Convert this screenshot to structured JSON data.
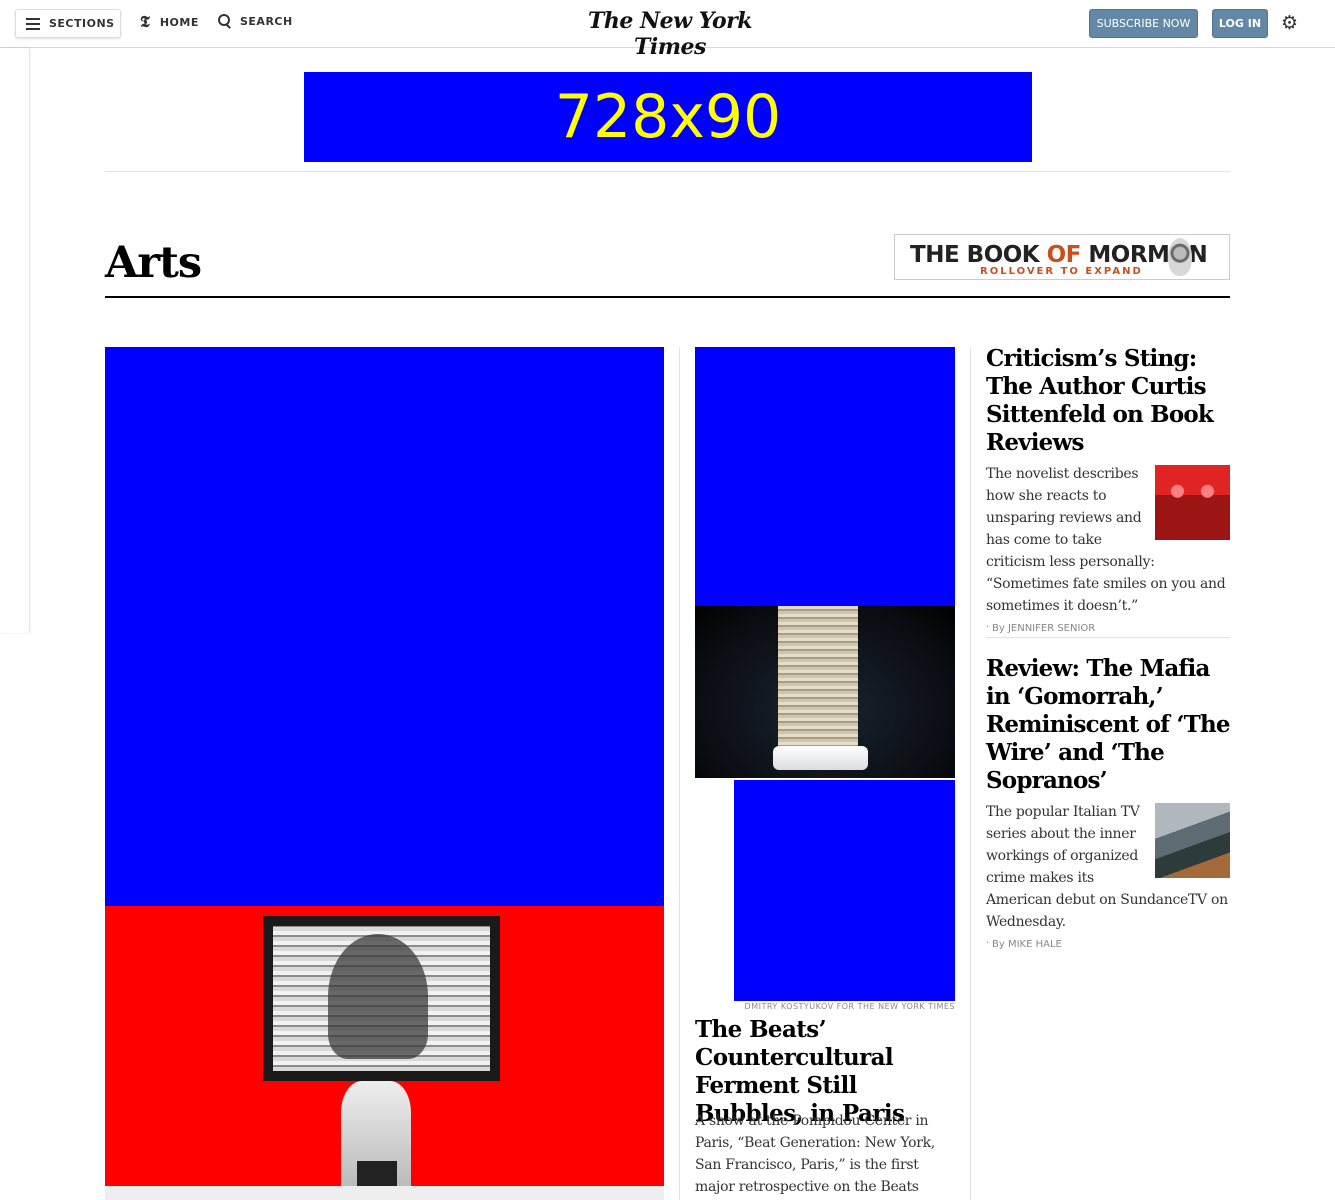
{
  "topbar": {
    "sections_label": "SECTIONS",
    "home_label": "HOME",
    "search_label": "SEARCH",
    "masthead": "The New York Times",
    "subscribe_label": "SUBSCRIBE NOW",
    "login_label": "LOG IN"
  },
  "ad": {
    "leaderboard_label": "728x90"
  },
  "section": {
    "title": "Arts"
  },
  "promo": {
    "title_part1": "THE BOOK ",
    "title_part2": "OF ",
    "title_part3": "MORMON",
    "subtitle": "ROLLOVER TO EXPAND"
  },
  "middle": {
    "photo_credit": "DMITRY KOSTYUKOV FOR THE NEW YORK TIMES",
    "headline": "The Beats’ Countercultural Ferment Still Bubbles, in Paris",
    "summary": "A show at the Pompidou Center in Paris, “Beat Generation: New York, San Francisco, Paris,” is the first major retrospective on the Beats since the"
  },
  "right": {
    "stories": [
      {
        "headline": "Criticism’s Sting: The Author Curtis Sittenfeld on Book Reviews",
        "summary": "The novelist describes how she reacts to unsparing reviews and has come to take criticism less personally: “Sometimes fate smiles on you and sometimes it doesn’t.”",
        "byline": "By JENNIFER SENIOR"
      },
      {
        "headline": "Review: The Mafia in ‘Gomorrah,’ Reminiscent of ‘The Wire’ and ‘The Sopranos’",
        "summary": "The popular Italian TV series about the inner workings of organized crime makes its American debut on SundanceTV on Wednesday.",
        "byline": "By MIKE HALE"
      }
    ]
  },
  "icons": {
    "menu": "hamburger-icon",
    "home": "nyt-t-icon",
    "search": "search-icon",
    "settings": "gear-icon"
  },
  "colors": {
    "button_blue": "#6288a5",
    "ad_blue": "#0000ff",
    "ad_text": "#ffff00",
    "art_red": "#ff0000",
    "promo_orange": "#c8501e"
  }
}
